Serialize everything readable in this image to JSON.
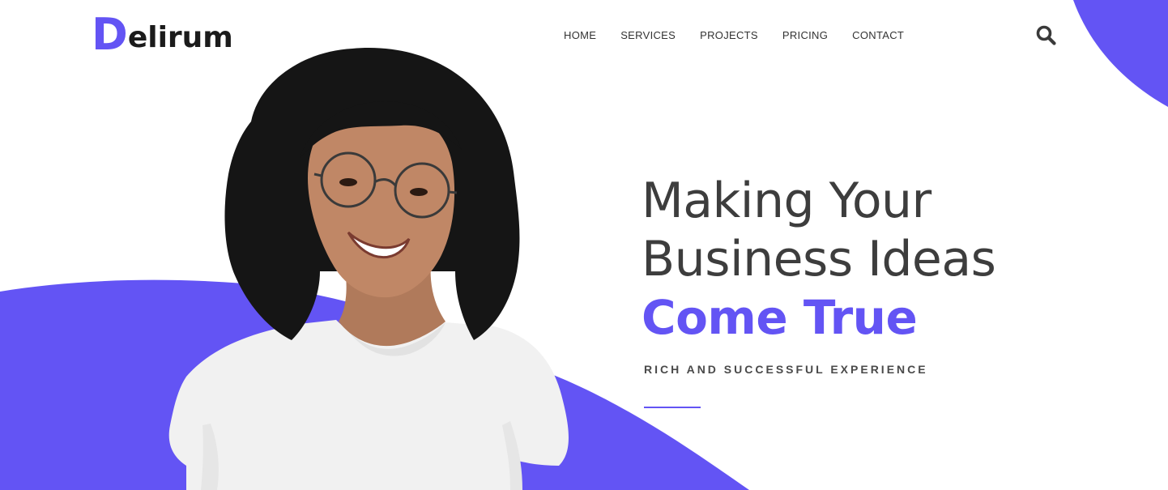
{
  "colors": {
    "accent": "#6354f4",
    "text_dark": "#3d3d3d",
    "nav_text": "#333333",
    "background": "#ffffff"
  },
  "header": {
    "logo": {
      "initial": "D",
      "rest": "elirum"
    },
    "nav": [
      {
        "label": "HOME"
      },
      {
        "label": "SERVICES"
      },
      {
        "label": "PROJECTS"
      },
      {
        "label": "PRICING"
      },
      {
        "label": "CONTACT"
      }
    ],
    "search_icon": "search-icon"
  },
  "hero": {
    "line1": "Making Your",
    "line2": "Business Ideas",
    "accent_line": "Come True",
    "tagline": "RICH AND SUCCESSFUL EXPERIENCE"
  }
}
